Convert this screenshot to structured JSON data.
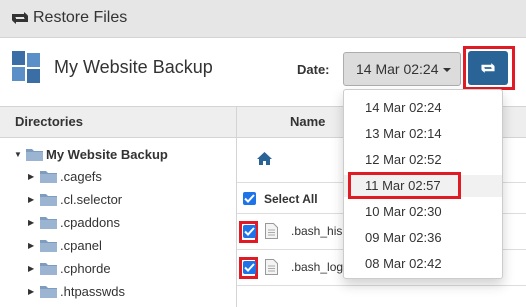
{
  "titlebar": {
    "title": "Restore Files",
    "icon": "restore-icon"
  },
  "header": {
    "site_title": "My Website Backup",
    "date_label": "Date:",
    "date_value": "14 Mar 02:24",
    "restore_icon": "restore-icon"
  },
  "directories": {
    "header": "Directories",
    "root": "My Website Backup",
    "items": [
      ".cagefs",
      ".cl.selector",
      ".cpaddons",
      ".cpanel",
      ".cphorde",
      ".htpasswds"
    ]
  },
  "files": {
    "header": "Name",
    "home_icon": "home-icon",
    "select_all": "Select All",
    "rows": [
      {
        "name": ".bash_his",
        "checked": true
      },
      {
        "name": ".bash_log",
        "checked": true
      }
    ]
  },
  "date_dropdown": {
    "options": [
      "14 Mar 02:24",
      "13 Mar 02:14",
      "12 Mar 02:52",
      "11 Mar 02:57",
      "10 Mar 02:30",
      "09 Mar 02:36",
      "08 Mar 02:42"
    ],
    "highlighted": "11 Mar 02:57"
  },
  "colors": {
    "accent": "#2a6496",
    "checkbox": "#1e73e8",
    "highlight": "#e01b24",
    "folder": "#7d9cbf"
  }
}
